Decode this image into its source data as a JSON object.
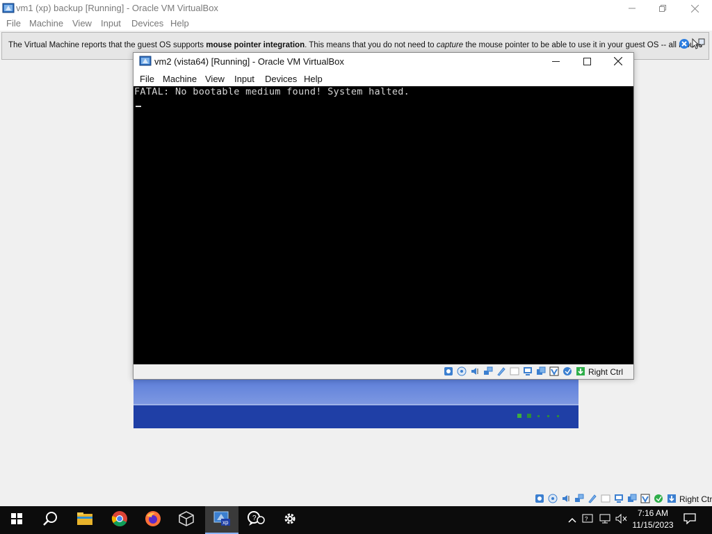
{
  "outer_window": {
    "title": "vm1 (xp) backup [Running] - Oracle VM VirtualBox",
    "menu": [
      "File",
      "Machine",
      "View",
      "Input",
      "Devices",
      "Help"
    ]
  },
  "notification": {
    "text_part1": "The Virtual Machine reports that the guest OS supports ",
    "text_bold": "mouse pointer integration",
    "text_part2": ". This means that you do not need to ",
    "text_italic": "capture",
    "text_part3": " the mouse pointer to be able to use it in your guest OS -- all mouse"
  },
  "inner_window": {
    "title": "vm2 (vista64) [Running] - Oracle VM VirtualBox",
    "menu": [
      "File",
      "Machine",
      "View",
      "Input",
      "Devices",
      "Help"
    ],
    "console_message": "FATAL: No bootable medium found! System halted.",
    "host_key": "Right Ctrl"
  },
  "outer_status": {
    "host_key": "Right Ctrl"
  },
  "taskbar": {
    "items": [
      "start-icon",
      "search-icon",
      "file-explorer-icon",
      "chrome-icon",
      "firefox-icon",
      "virtualbox-icon",
      "virtualbox-vm-icon",
      "feedback-icon",
      "settings-icon"
    ],
    "clock_time": "7:16 AM",
    "clock_date": "11/15/2023"
  },
  "colors": {
    "taskbar_bg": "#0c0c0c",
    "console_bg": "#000000",
    "console_text": "#d6d6d6",
    "xp_blue": "#2f52c0",
    "accent": "#1a6fd6"
  }
}
